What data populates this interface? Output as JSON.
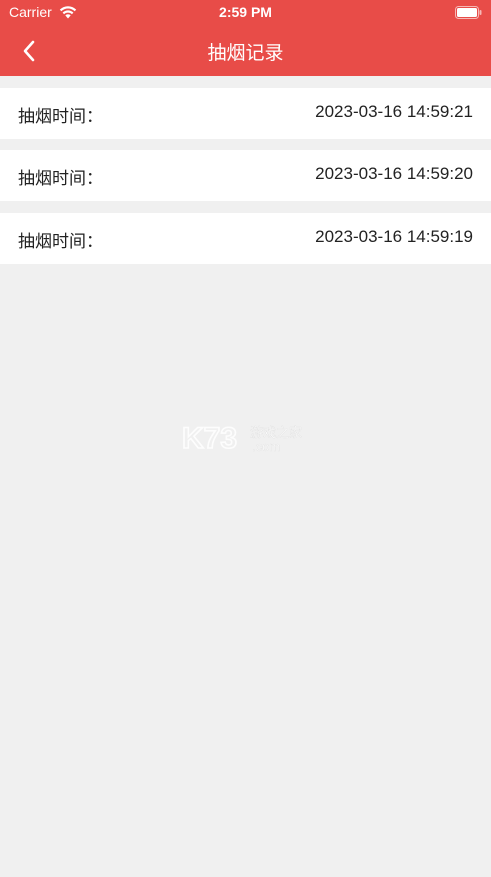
{
  "status_bar": {
    "carrier": "Carrier",
    "time": "2:59 PM",
    "wifi_icon": "wifi-icon",
    "battery_icon": "battery-icon"
  },
  "nav": {
    "title": "抽烟记录",
    "back_icon": "chevron-left-icon"
  },
  "records": [
    {
      "label": "抽烟时间：",
      "value": "2023-03-16 14:59:21"
    },
    {
      "label": "抽烟时间：",
      "value": "2023-03-16 14:59:20"
    },
    {
      "label": "抽烟时间：",
      "value": "2023-03-16 14:59:19"
    }
  ],
  "watermark": {
    "logo": "K73",
    "text": "游戏之家",
    "domain": ".com"
  },
  "colors": {
    "header": "#e84c48",
    "background": "#f0f0f0",
    "row": "#ffffff",
    "text": "#222222"
  }
}
